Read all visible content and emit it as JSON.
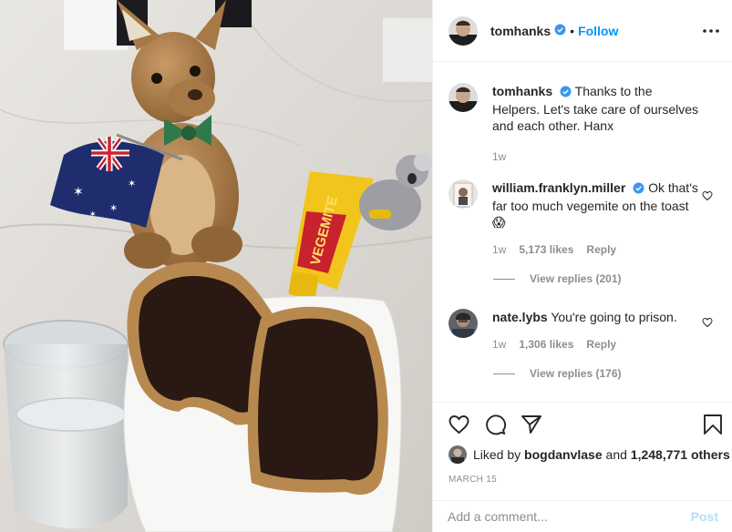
{
  "header": {
    "username": "tomhanks",
    "separator": "•",
    "follow_label": "Follow"
  },
  "caption": {
    "username": "tomhanks",
    "text": "Thanks to the Helpers. Let's take care of ourselves and each other. Hanx",
    "time": "1w"
  },
  "comments": [
    {
      "username": "william.franklyn.miller",
      "verified": true,
      "text": "Ok that's far too much vegemite on the toast 😱",
      "time": "1w",
      "likes": "5,173 likes",
      "reply_label": "Reply",
      "view_replies": "View replies (201)"
    },
    {
      "username": "nate.lybs",
      "verified": false,
      "text": "You're going to prison.",
      "time": "1w",
      "likes": "1,306 likes",
      "reply_label": "Reply",
      "view_replies": "View replies (176)"
    }
  ],
  "likes_line": {
    "prefix": "Liked by",
    "user": "bogdanvlase",
    "middle": "and",
    "count": "1,248,771 others"
  },
  "date": "MARCH 15",
  "add_comment": {
    "placeholder": "Add a comment...",
    "post_label": "Post"
  },
  "colors": {
    "link_blue": "#0095f6",
    "verified_blue": "#3897f0",
    "muted": "#8e8e8e",
    "post_disabled": "#b2dffc"
  },
  "icons": {
    "like": "heart-icon",
    "comment": "comment-icon",
    "share": "share-icon",
    "save": "bookmark-icon",
    "more": "more-options-icon"
  }
}
